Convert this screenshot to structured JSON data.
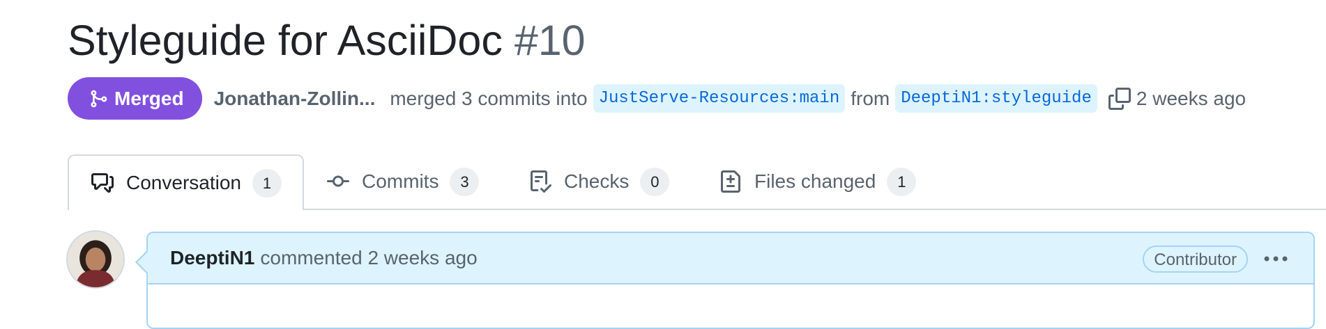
{
  "pr": {
    "title": "Styleguide for AsciiDoc",
    "number": "#10",
    "state": "Merged",
    "author": "Jonathan-Zollin...",
    "merged_text": "merged 3 commits into",
    "base_branch": "JustServe-Resources:main",
    "from_text": "from",
    "head_branch": "DeeptiN1:styleguide",
    "time_ago": "2 weeks ago"
  },
  "colors": {
    "merged": "#8250df",
    "link": "#0969da",
    "branch_bg": "#ddf4ff",
    "comment_header_bg": "#ddf4ff"
  },
  "tabs": [
    {
      "label": "Conversation",
      "count": "1",
      "icon": "comment-discussion-icon",
      "selected": true
    },
    {
      "label": "Commits",
      "count": "3",
      "icon": "git-commit-icon",
      "selected": false
    },
    {
      "label": "Checks",
      "count": "0",
      "icon": "checklist-icon",
      "selected": false
    },
    {
      "label": "Files changed",
      "count": "1",
      "icon": "file-diff-icon",
      "selected": false
    }
  ],
  "comment": {
    "author": "DeeptiN1",
    "meta": "commented 2 weeks ago",
    "role": "Contributor",
    "menu_icon": "kebab-horizontal-icon"
  }
}
